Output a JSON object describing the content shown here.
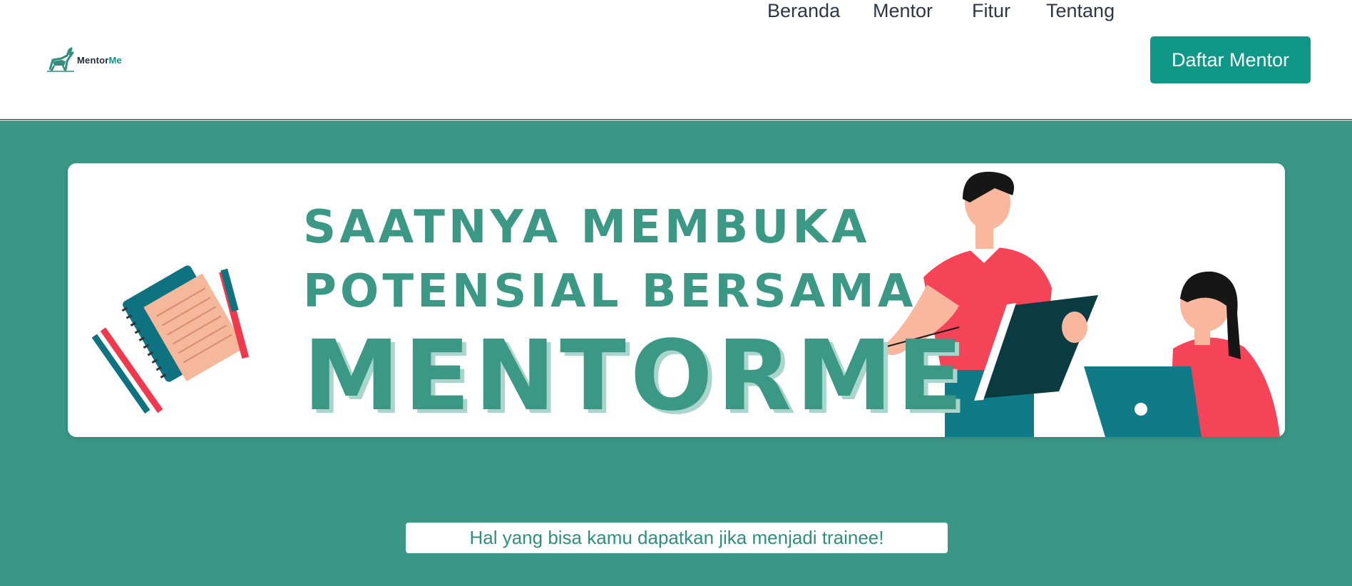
{
  "brand": {
    "name_part1": "Mentor",
    "name_part2": "Me",
    "accent": "#0f9888"
  },
  "nav": {
    "links": [
      "Beranda",
      "Mentor",
      "Fitur",
      "Tentang"
    ],
    "cta_label": "Daftar Mentor"
  },
  "hero": {
    "background": "#3a9685",
    "headline": {
      "line1": "SAATNYA MEMBUKA",
      "line2": "POTENSIAL BERSAMA",
      "line3": "MENTORME"
    },
    "illustration_icons": [
      "notebook-icon",
      "pencil-icon",
      "man-with-tablet-icon",
      "woman-with-laptop-icon"
    ],
    "subheading": "Hal yang bisa kamu dapatkan jika menjadi trainee!"
  }
}
